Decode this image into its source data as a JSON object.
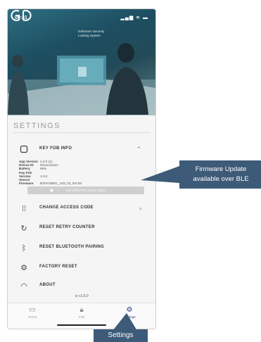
{
  "status_bar": {
    "time": "09:41",
    "icons": "▂▄▆ ≋ ▬"
  },
  "hero": {
    "brand_line1": "Gehmann Security",
    "brand_line2": "Locking System"
  },
  "settings": {
    "title": "SETTINGS",
    "key_fob_info": {
      "label": "KEY FOB INFO",
      "details": [
        {
          "key": "App Version",
          "value": "1.0.0 (1)"
        },
        {
          "key": "Device ID",
          "value": "00111111111"
        },
        {
          "key": "Battery",
          "value": "96%"
        },
        {
          "key": "Key Fob Version",
          "value": "1.0.0"
        },
        {
          "key": "Sensor Firmware",
          "value": "BTKFOBRC_A03_03_fert.08"
        }
      ],
      "no_update_label": "NO UPDATE AVAILABLE"
    },
    "items": [
      {
        "label": "CHANGE ACCESS CODE",
        "icon": "keypad-icon"
      },
      {
        "label": "RESET RETRY COUNTER",
        "icon": "refresh-icon"
      },
      {
        "label": "RESET BLUETOOTH PAIRING",
        "icon": "bluetooth-icon"
      },
      {
        "label": "FACTORY RESET",
        "icon": "factory-icon"
      },
      {
        "label": "ABOUT",
        "icon": "info-icon"
      }
    ],
    "version_text": "v1.0.0"
  },
  "tabs": [
    {
      "label": "Home",
      "icon": "home-icon"
    },
    {
      "label": "Fob",
      "icon": "lock-icon"
    },
    {
      "label": "Settings",
      "icon": "gear-icon"
    }
  ],
  "annotations": {
    "firmware_callout_line1": "Firmware Update",
    "firmware_callout_line2": "available over BLE",
    "settings_label": "Settings"
  },
  "colors": {
    "accent": "#2a3a8a",
    "callout": "#3d5a78"
  }
}
